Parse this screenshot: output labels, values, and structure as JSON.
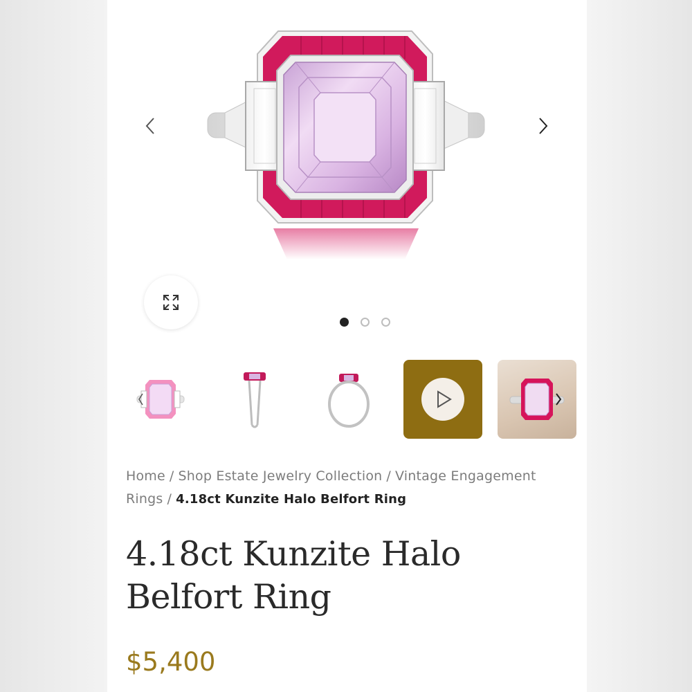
{
  "colors": {
    "accent_gold": "#9a7a1e",
    "video_thumb_bg": "#8e6d12",
    "ruby": "#d4145a",
    "kunzite": "#e6c4ec"
  },
  "gallery": {
    "prev_icon": "chevron-left-icon",
    "next_icon": "chevron-right-icon",
    "expand_icon": "expand-arrows-icon",
    "dots_count": 3,
    "active_dot_index": 0,
    "thumbnails": [
      {
        "kind": "image",
        "depicts": "ring-front"
      },
      {
        "kind": "image",
        "depicts": "ring-side"
      },
      {
        "kind": "image",
        "depicts": "ring-profile"
      },
      {
        "kind": "video",
        "icon": "play-icon"
      },
      {
        "kind": "image",
        "depicts": "ring-photo"
      }
    ]
  },
  "breadcrumb": {
    "items": [
      "Home",
      "Shop Estate Jewelry Collection",
      "Vintage Engagement Rings"
    ],
    "separator": "/",
    "current": "4.18ct Kunzite Halo Belfort Ring"
  },
  "product": {
    "title": "4.18ct Kunzite Halo Belfort Ring",
    "price": "$5,400"
  }
}
